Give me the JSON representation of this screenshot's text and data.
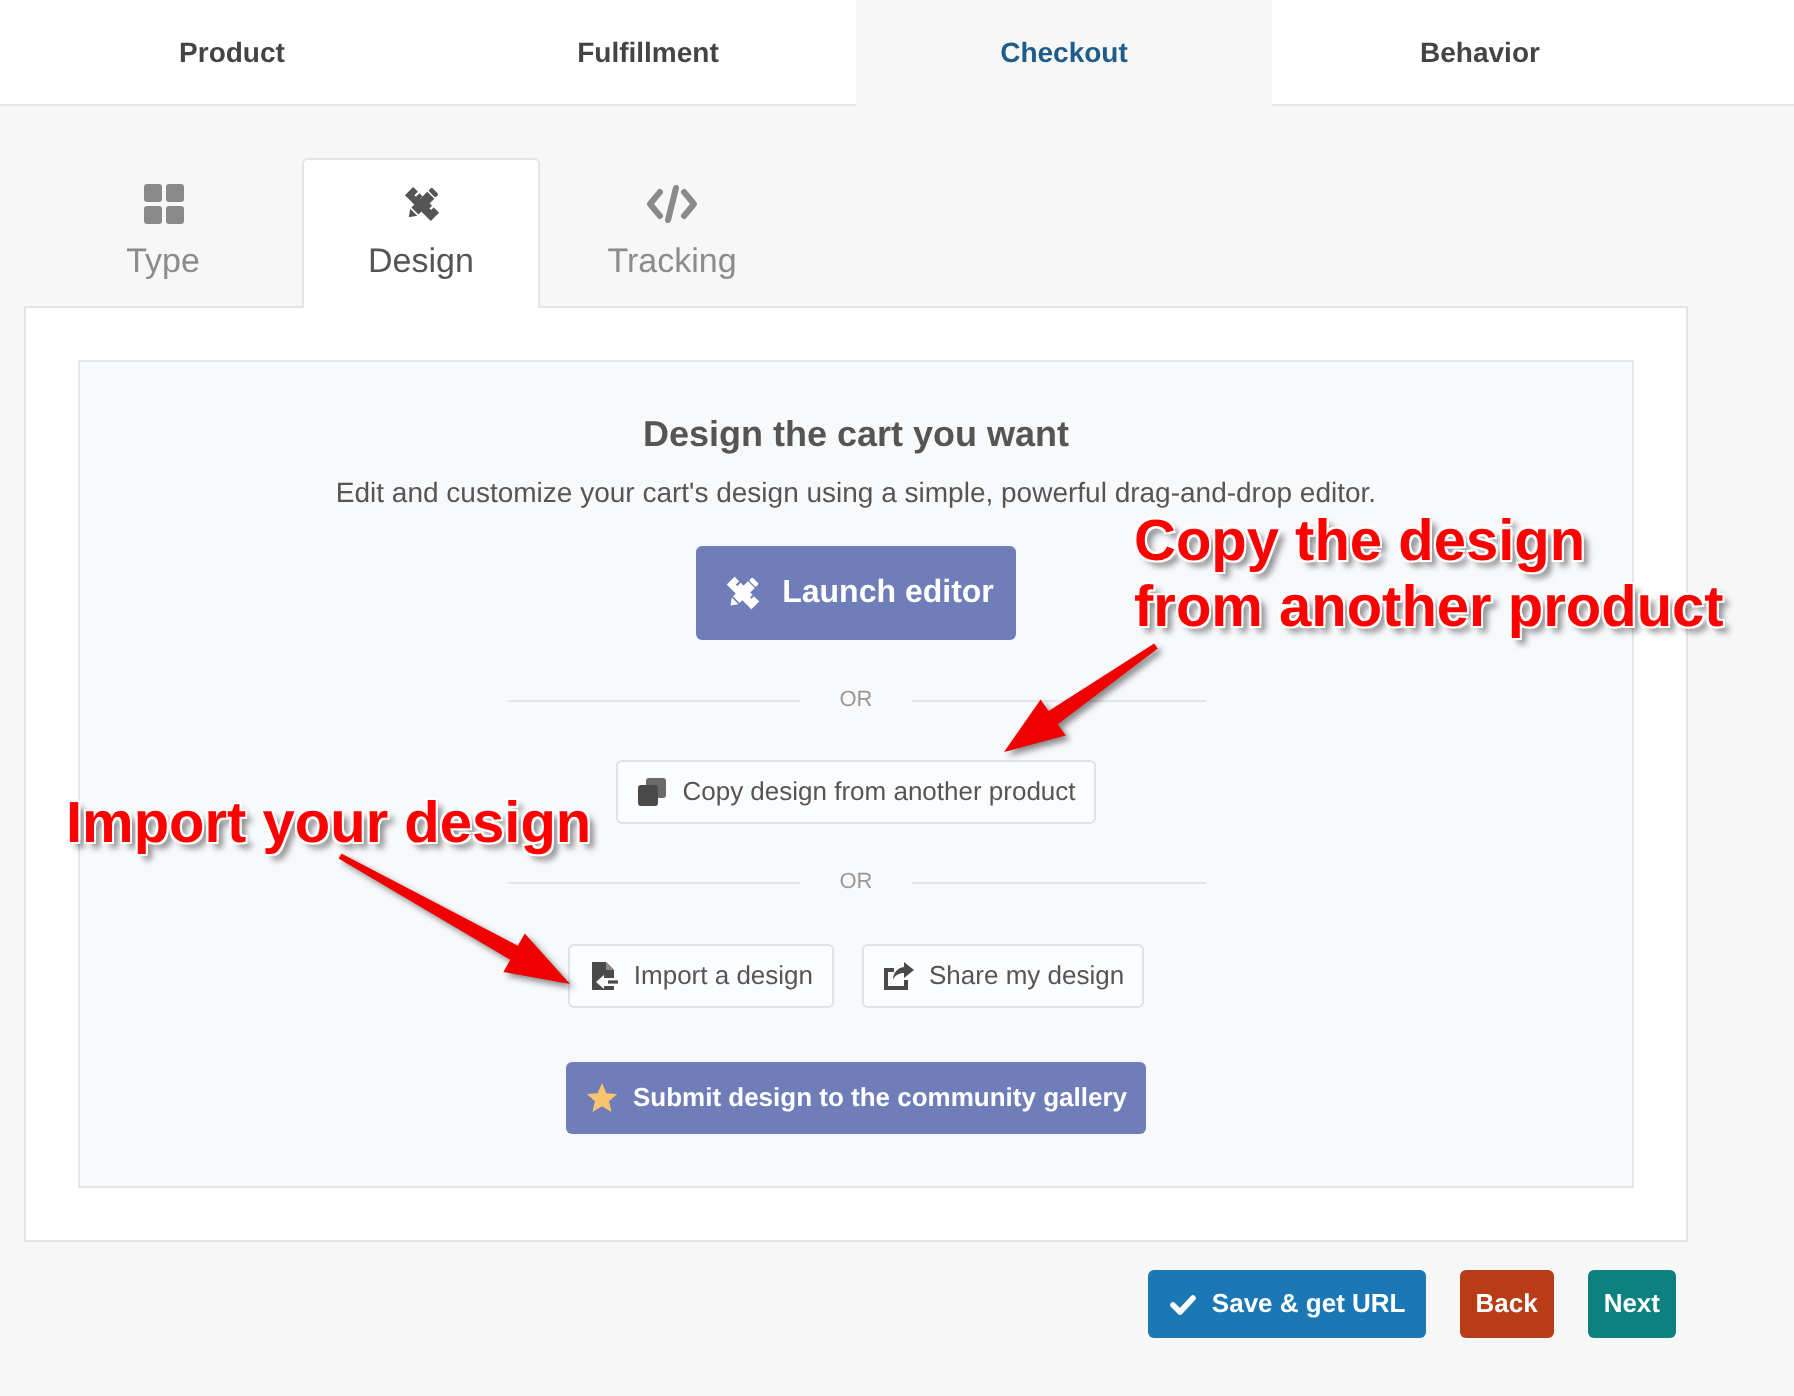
{
  "top_tabs": [
    {
      "label": "Product",
      "selected": false
    },
    {
      "label": "Fulfillment",
      "selected": false
    },
    {
      "label": "Checkout",
      "selected": true
    },
    {
      "label": "Behavior",
      "selected": false
    }
  ],
  "sub_tabs": [
    {
      "label": "Type",
      "selected": false
    },
    {
      "label": "Design",
      "selected": true
    },
    {
      "label": "Tracking",
      "selected": false
    }
  ],
  "design_panel": {
    "title": "Design the cart you want",
    "subtitle": "Edit and customize your cart's design using a simple, powerful drag-and-drop editor.",
    "launch_button": "Launch editor",
    "dividers": [
      "OR",
      "OR"
    ],
    "copy_button": "Copy design from another product",
    "import_button": "Import a design",
    "share_button": "Share my design",
    "submit_button": "Submit design to the community gallery"
  },
  "actions": [
    {
      "label": "Save & get URL",
      "kind": "save"
    },
    {
      "label": "Back",
      "kind": "back"
    },
    {
      "label": "Next",
      "kind": "next"
    }
  ],
  "annotations": [
    {
      "text": "Copy the design\nfrom another product"
    },
    {
      "text": "Import your design"
    }
  ]
}
